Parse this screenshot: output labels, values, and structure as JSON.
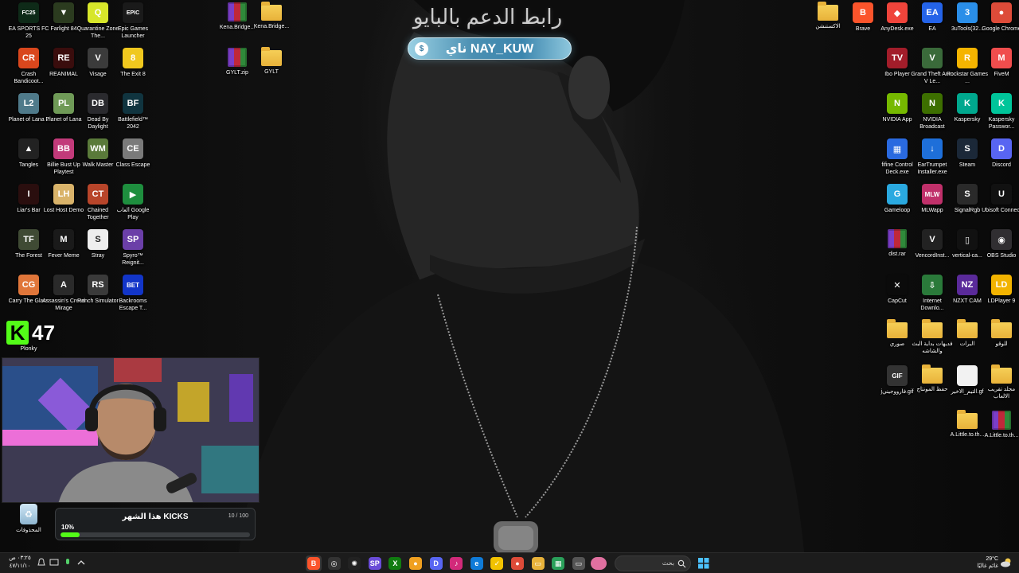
{
  "banner": {
    "title": "رابط الدعم بالبايو",
    "pill_text": "ناي NAY_KUW",
    "coin_symbol": "$"
  },
  "counter": {
    "k_letter": "K",
    "value": "47"
  },
  "desktop_left": [
    {
      "label": "EA SPORTS FC 25",
      "icon": "fc25-icon",
      "text": "FC25",
      "color": "#0e2a18"
    },
    {
      "label": "Farlight 84",
      "icon": "farlight-icon",
      "text": "▼",
      "color": "#2b3b1f"
    },
    {
      "label": "Quarantine Zone The...",
      "icon": "quarantine-icon",
      "text": "Q",
      "color": "#d7e62a"
    },
    {
      "label": "Epic Games Launcher",
      "icon": "epic-games-icon",
      "text": "EPIC",
      "color": "#1a1a1a"
    },
    {
      "label": "Crash Bandicoot...",
      "icon": "crash-icon",
      "text": "CR",
      "color": "#d9471d"
    },
    {
      "label": "REANIMAL",
      "icon": "reanimal-icon",
      "text": "RE",
      "color": "#3a0d0d"
    },
    {
      "label": "Visage",
      "icon": "visage-icon",
      "text": "V",
      "color": "#3b3b3b"
    },
    {
      "label": "The Exit 8",
      "icon": "exit8-icon",
      "text": "8",
      "color": "#f0c81e"
    },
    {
      "label": "Planet of Lana 2",
      "icon": "lana2-icon",
      "text": "L2",
      "color": "#4f7a8a"
    },
    {
      "label": "Planet of Lana",
      "icon": "lana-icon",
      "text": "PL",
      "color": "#6f9a57"
    },
    {
      "label": "Dead By Daylight",
      "icon": "dbd-icon",
      "text": "DB",
      "color": "#2a2a2e"
    },
    {
      "label": "Battlefield™ 2042",
      "icon": "battlefield-icon",
      "text": "BF",
      "color": "#10343f"
    },
    {
      "label": "Tangles",
      "icon": "tangles-icon",
      "text": "▲",
      "color": "#222"
    },
    {
      "label": "Billie Bust Up Playtest",
      "icon": "billie-icon",
      "text": "BB",
      "color": "#c23a7a"
    },
    {
      "label": "Walk Master",
      "icon": "walkmaster-icon",
      "text": "WM",
      "color": "#5a7a3a"
    },
    {
      "label": "Class Escape",
      "icon": "class-escape-icon",
      "text": "CE",
      "color": "#7a7a7a"
    },
    {
      "label": "Liar's Bar",
      "icon": "liars-bar-icon",
      "text": "I",
      "color": "#2a0e0e"
    },
    {
      "label": "Lost Host Demo",
      "icon": "lost-host-icon",
      "text": "LH",
      "color": "#d9b36a"
    },
    {
      "label": "Chained Together",
      "icon": "chained-icon",
      "text": "CT",
      "color": "#b8452a"
    },
    {
      "label": "ألعاب Google Play",
      "icon": "google-play-icon",
      "text": "▶",
      "color": "#1e8e3e"
    },
    {
      "label": "The Forest",
      "icon": "forest-icon",
      "text": "TF",
      "color": "#3f4a34"
    },
    {
      "label": "Fever Meme",
      "icon": "fever-meme-icon",
      "text": "M",
      "color": "#1a1a1a"
    },
    {
      "label": "Stray",
      "icon": "stray-icon",
      "text": "S",
      "color": "#eeeeee"
    },
    {
      "label": "Spyro™ Reignit...",
      "icon": "spyro-icon",
      "text": "SP",
      "color": "#6b3fa8"
    },
    {
      "label": "Carry The Glass",
      "icon": "carry-glass-icon",
      "text": "CG",
      "color": "#e0763a"
    },
    {
      "label": "Assassin's Creed Mirage",
      "icon": "ac-mirage-icon",
      "text": "A",
      "color": "#2a2a2a"
    },
    {
      "label": "Ranch Simulator",
      "icon": "ranch-icon",
      "text": "RS",
      "color": "#3a3a3a"
    },
    {
      "label": "Backrooms Escape T...",
      "icon": "backrooms-icon",
      "text": "BET",
      "color": "#1235c8"
    },
    {
      "label": "Plonky",
      "icon": "plonky-icon",
      "text": "P",
      "color": "#4a8a3a"
    }
  ],
  "desktop_mid": [
    {
      "label": "Kena.Bridge...",
      "type": "rar"
    },
    {
      "label": "Kena.Bridge...",
      "type": "folder"
    },
    {
      "label": "GYLT.zip",
      "type": "rar"
    },
    {
      "label": "GYLT",
      "type": "folder"
    }
  ],
  "desktop_right": [
    {
      "label": "الاكستنشن",
      "type": "folder"
    },
    {
      "label": "Brave",
      "icon": "brave-icon",
      "text": "B",
      "color": "#fb542b"
    },
    {
      "label": "AnyDesk.exe",
      "icon": "anydesk-icon",
      "text": "◆",
      "color": "#ef443b"
    },
    {
      "label": "EA",
      "icon": "ea-icon",
      "text": "EA",
      "color": "#2463e8"
    },
    {
      "label": "3uTools(32...",
      "icon": "3utools-icon",
      "text": "3",
      "color": "#2a8ee8"
    },
    {
      "label": "Google Chrome",
      "icon": "chrome-icon",
      "text": "●",
      "color": "#dd4b39"
    },
    {
      "label": "Ibo Player",
      "icon": "ibo-player-icon",
      "text": "TV",
      "color": "#a21d2a"
    },
    {
      "label": "Grand Theft Auto V Le...",
      "icon": "gta-icon",
      "text": "V",
      "color": "#3a6a3a"
    },
    {
      "label": "Rockstar Games ...",
      "icon": "rockstar-icon",
      "text": "R",
      "color": "#f5b400"
    },
    {
      "label": "FiveM",
      "icon": "fivem-icon",
      "text": "M",
      "color": "#f04d4d"
    },
    {
      "label": "NVIDIA App",
      "icon": "nvidia-app-icon",
      "text": "N",
      "color": "#76b900"
    },
    {
      "label": "NVIDIA Broadcast",
      "icon": "nvidia-broadcast-icon",
      "text": "N",
      "color": "#3d6f00"
    },
    {
      "label": "Kaspersky",
      "icon": "kaspersky-icon",
      "text": "K",
      "color": "#00a88e"
    },
    {
      "label": "Kaspersky Passwor...",
      "icon": "kaspersky-pw-icon",
      "text": "K",
      "color": "#00c59a"
    },
    {
      "label": "fifine Control Deck.exe",
      "icon": "fifine-icon",
      "text": "▦",
      "color": "#2a6ae0"
    },
    {
      "label": "EarTrumpet Installer.exe",
      "icon": "eartrumpet-icon",
      "text": "↓",
      "color": "#1e6fd9"
    },
    {
      "label": "Steam",
      "icon": "steam-icon",
      "text": "S",
      "color": "#1b2838"
    },
    {
      "label": "Discord",
      "icon": "discord-icon",
      "text": "D",
      "color": "#5865f2"
    },
    {
      "label": "Gameloop",
      "icon": "gameloop-icon",
      "text": "G",
      "color": "#2aa9e0"
    },
    {
      "label": "MLWapp",
      "icon": "mlwapp-icon",
      "text": "MLW",
      "color": "#c0306a"
    },
    {
      "label": "SignalRgb",
      "icon": "signalrgb-icon",
      "text": "S",
      "color": "#2a2a2a"
    },
    {
      "label": "Ubisoft Connect",
      "icon": "ubisoft-icon",
      "text": "U",
      "color": "#111"
    },
    {
      "label": "dist.rar",
      "type": "rar"
    },
    {
      "label": "VencordInst...",
      "icon": "vencord-icon",
      "text": "V",
      "color": "#222"
    },
    {
      "label": "vertical-ca...",
      "icon": "vertical-icon",
      "text": "▯",
      "color": "#111"
    },
    {
      "label": "OBS Studio",
      "icon": "obs-icon",
      "text": "◉",
      "color": "#302e31"
    },
    {
      "label": "CapCut",
      "icon": "capcut-icon",
      "text": "✕",
      "color": "#0b0b0b"
    },
    {
      "label": "Internet Downlo...",
      "icon": "idm-icon",
      "text": "⇩",
      "color": "#2a7a3a"
    },
    {
      "label": "NZXT CAM",
      "icon": "nzxt-icon",
      "text": "NZ",
      "color": "#5a2a9a"
    },
    {
      "label": "LDPlayer 9",
      "icon": "ldplayer-icon",
      "text": "LD",
      "color": "#f2b300"
    },
    {
      "label": "صوري",
      "type": "folder"
    },
    {
      "label": "فديهات بداية البث والشاشه",
      "type": "folder"
    },
    {
      "label": "البرات",
      "type": "folder"
    },
    {
      "label": "للوقو",
      "type": "folder"
    },
    {
      "label": "jفارووجيني.gif",
      "icon": "gif-icon",
      "text": "GIF",
      "color": "#333"
    },
    {
      "label": "حفظ المونتاج",
      "type": "folder"
    },
    {
      "label": "التيم_الاخير.gf",
      "icon": "file-icon",
      "text": "",
      "color": "#f2f2f2"
    },
    {
      "label": "مجلد تقريب الالعاب",
      "type": "folder"
    },
    {
      "label": "A.Little.to.th...",
      "type": "folder"
    },
    {
      "label": "A.Little.to.th...",
      "type": "rar"
    }
  ],
  "kicks": {
    "title": "هذا الشهر KICKS",
    "count": "10 / 100",
    "percent_label": "10%",
    "progress": 0.1,
    "bar_color": "#53fc18"
  },
  "recycle_bin": {
    "label": "المحذوفات"
  },
  "taskbar": {
    "time": "٠٣:٢٥ ص",
    "date": "٤٧/١١/١٠",
    "search_label": "بحث",
    "weather_temp": "29°C",
    "weather_desc": "غائم غالبًا",
    "apps": [
      {
        "name": "brave",
        "text": "B",
        "color": "#fb542b"
      },
      {
        "name": "davinci",
        "text": "◎",
        "color": "#333"
      },
      {
        "name": "chatgpt",
        "text": "✺",
        "color": "#222"
      },
      {
        "name": "app-blue",
        "text": "SP",
        "color": "#6a4cd8"
      },
      {
        "name": "xbox",
        "text": "X",
        "color": "#107c10"
      },
      {
        "name": "app-orange",
        "text": "●",
        "color": "#f0a020"
      },
      {
        "name": "discord",
        "text": "D",
        "color": "#5865f2"
      },
      {
        "name": "itunes",
        "text": "♪",
        "color": "#d22a7a"
      },
      {
        "name": "edge",
        "text": "e",
        "color": "#0f7bd8"
      },
      {
        "name": "norton",
        "text": "✓",
        "color": "#f2c200"
      },
      {
        "name": "chrome",
        "text": "●",
        "color": "#dd4b39"
      },
      {
        "name": "file-explorer",
        "text": "▭",
        "color": "#e8b23a"
      },
      {
        "name": "app-green",
        "text": "▦",
        "color": "#2aa05a"
      },
      {
        "name": "display",
        "text": "▭",
        "color": "#555"
      },
      {
        "name": "pill-app",
        "text": "",
        "color": "#e070a0"
      }
    ]
  }
}
